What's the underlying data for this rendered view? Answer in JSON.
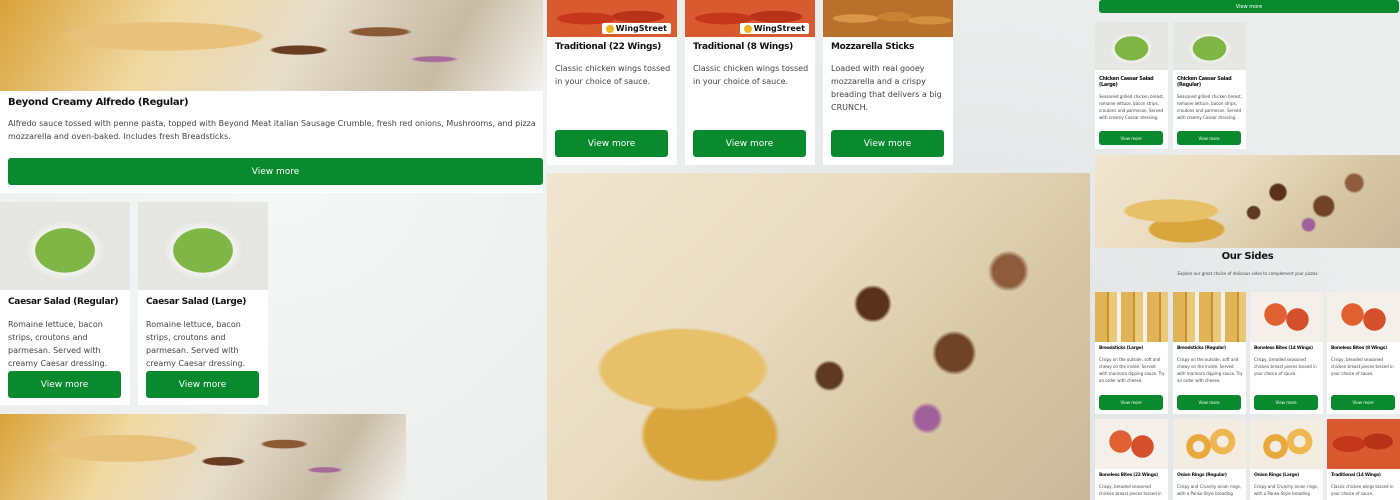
{
  "colors": {
    "button": "#0a8a2e",
    "page_bg": "#eceeee"
  },
  "view_more": "View more",
  "wingstreet_brand": "WingStreet",
  "main": {
    "alfredo": {
      "title": "Beyond Creamy Alfredo (Regular)",
      "desc": "Alfredo sauce tossed with penne pasta, topped with Beyond Meat italian Sausage Crumble, fresh red onions, Mushrooms, and pizza mozzarella and oven-baked. Includes fresh Breadsticks."
    },
    "salads": [
      {
        "title": "Caesar Salad (Regular)",
        "desc": "Romaine lettuce, bacon strips, croutons and parmesan. Served with creamy Caesar dressing."
      },
      {
        "title": "Caesar Salad (Large)",
        "desc": "Romaine lettuce, bacon strips, croutons and parmesan. Served with creamy Caesar dressing."
      }
    ],
    "top_items": [
      {
        "title": "Traditional (22 Wings)",
        "desc": "Classic chicken wings tossed in your choice of sauce."
      },
      {
        "title": "Traditional (8 Wings)",
        "desc": "Classic chicken wings tossed in your choice of sauce."
      },
      {
        "title": "Mozzarella Sticks",
        "desc": "Loaded with real gooey mozzarella and a crispy breading that delivers a big CRUNCH."
      }
    ]
  },
  "right_panel": {
    "salads": [
      {
        "title": "Chicken Caesar Salad (Large)",
        "desc": "Seasoned grilled chicken breast, romaine lettuce, bacon strips, croutons and parmesan. Served with creamy Caesar dressing."
      },
      {
        "title": "Chicken Caesar Salad (Regular)",
        "desc": "Seasoned grilled chicken breast, romaine lettuce, bacon strips, croutons and parmesan. Served with creamy Caesar dressing."
      }
    ],
    "sides_heading": "Our Sides",
    "sides_sub": "Explore our great choice of delicious sides to complement your pizzas",
    "sides": [
      {
        "title": "Breadsticks (Large)",
        "desc": "Crispy on the outside, soft and chewy on the inside. Served with marinara dipping sauce. Try an order with cheese."
      },
      {
        "title": "Breadsticks (Regular)",
        "desc": "Crispy on the outside, soft and chewy on the inside. Served with marinara dipping sauce. Try an order with cheese."
      },
      {
        "title": "Boneless Bites (14 Wings)",
        "desc": "Crispy, breaded seasoned chicken breast pieces tossed in your choice of sauce."
      },
      {
        "title": "Boneless Bites (8 Wings)",
        "desc": "Crispy, breaded seasoned chicken breast pieces tossed in your choice of sauce."
      }
    ],
    "sides_row2": [
      {
        "title": "Boneless Bites (22 Wings)",
        "desc": "Crispy, breaded seasoned chicken breast pieces tossed in"
      },
      {
        "title": "Onion Rings (Regular)",
        "desc": "Crispy and Crunchy onion rings, with a Panko-Style breading"
      },
      {
        "title": "Onion Rings (Large)",
        "desc": "Crispy and Crunchy onion rings, with a Panko-Style breading"
      },
      {
        "title": "Traditional (14 Wings)",
        "desc": "Classic chicken wings tossed in your choice of sauce."
      }
    ]
  }
}
